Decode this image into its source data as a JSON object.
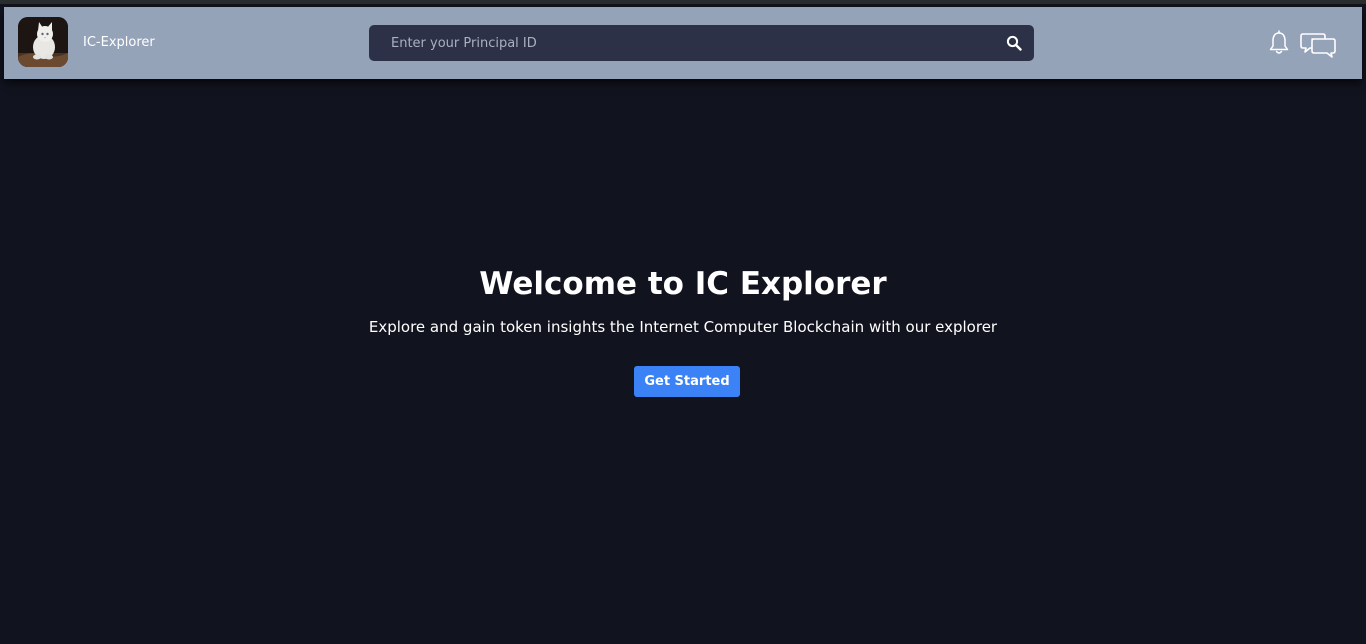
{
  "header": {
    "brand": "IC-Explorer",
    "search": {
      "placeholder": "Enter your Principal ID",
      "value": ""
    },
    "icons": [
      "cat-logo",
      "search-icon",
      "bell-icon",
      "chat-icon"
    ]
  },
  "hero": {
    "title": "Welcome to IC Explorer",
    "subtitle": "Explore and gain token insights the Internet Computer Blockchain with our explorer",
    "cta_label": "Get Started"
  },
  "colors": {
    "page_bg": "#11131e",
    "header_bg": "#95a3b9",
    "search_bg": "#2c3147",
    "accent": "#3b82f6"
  }
}
